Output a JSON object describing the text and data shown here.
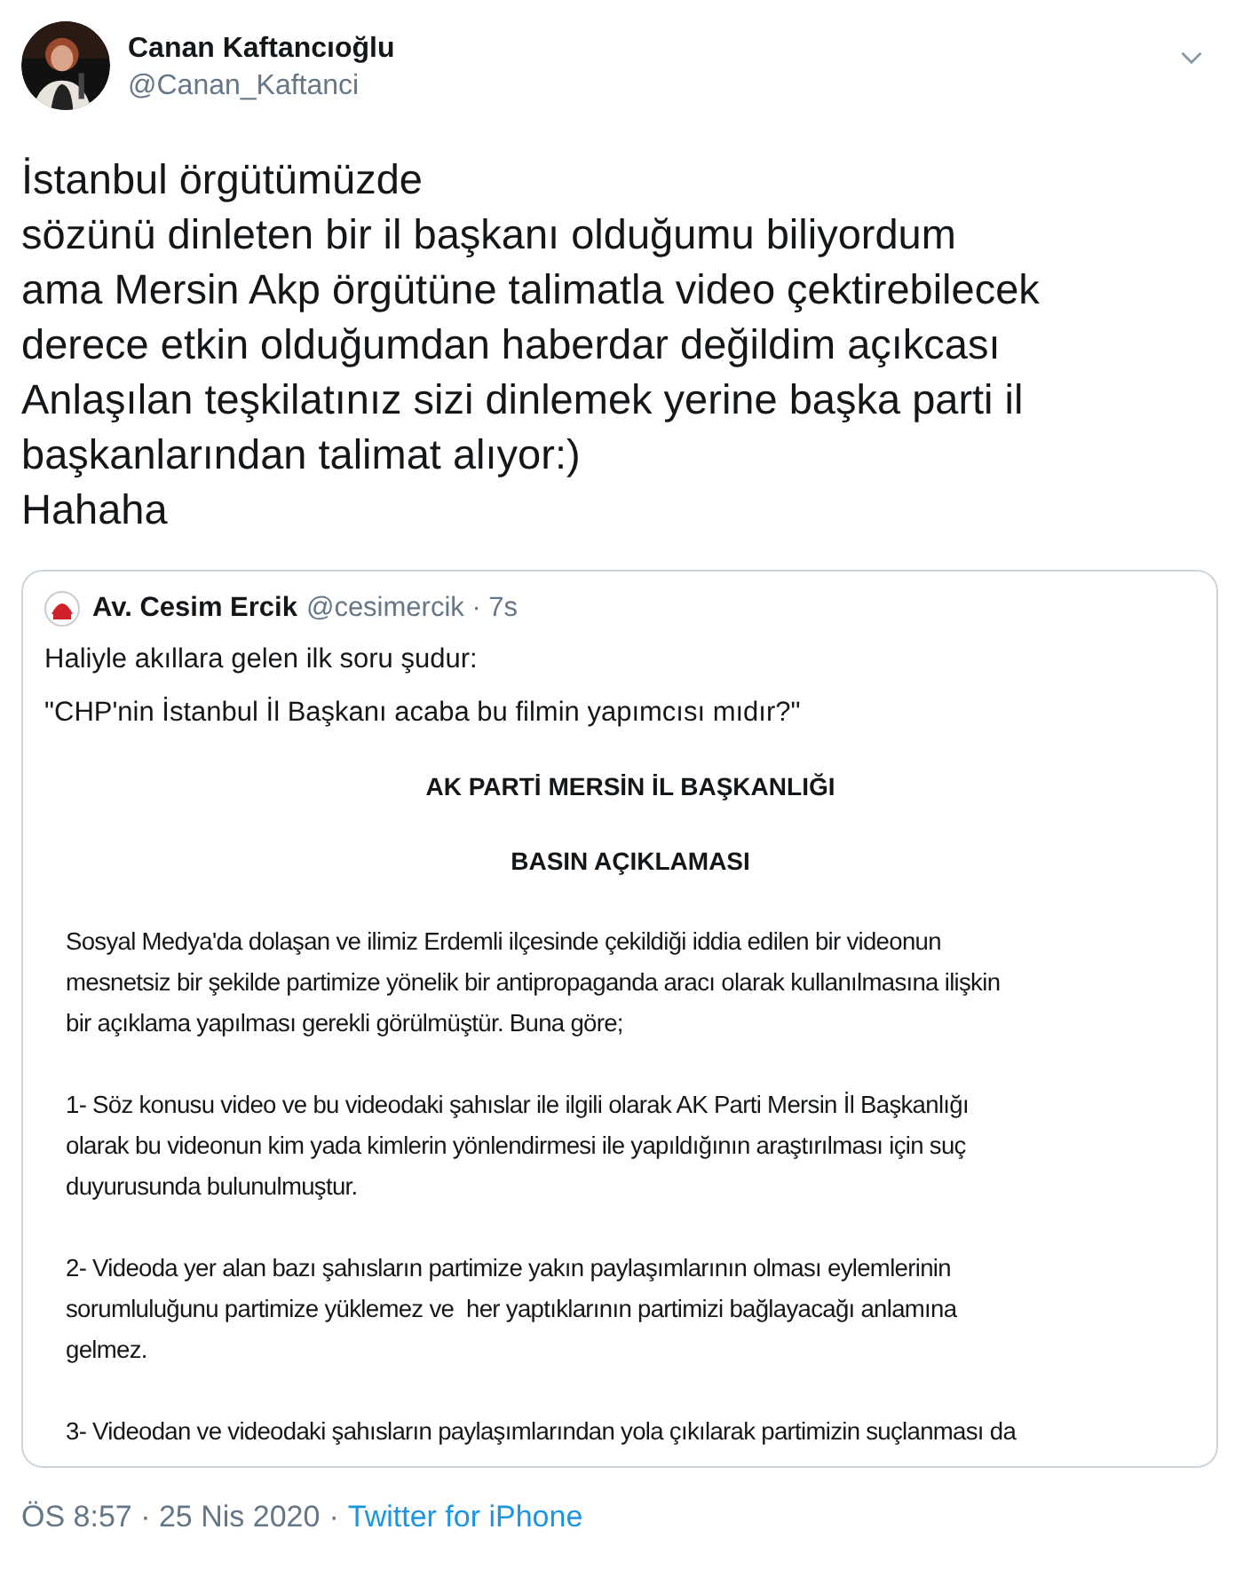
{
  "tweet": {
    "author": {
      "name": "Canan Kaftancıoğlu",
      "handle": "@Canan_Kaftanci"
    },
    "text": "İstanbul örgütümüzde\nsözünü dinleten bir il başkanı olduğumu biliyordum\nama Mersin Akp örgütüne talimatla video çektirebilecek\nderece etkin olduğumdan haberdar değildim açıkcası\nAnlaşılan teşkilatınız sizi dinlemek yerine başka parti il\nbaşkanlarından talimat alıyor:)\nHahaha",
    "quoted": {
      "author": {
        "name": "Av. Cesim Ercik",
        "meta": "@cesimercik · 7s"
      },
      "text": [
        "Haliyle akıllara gelen ilk soru şudur:",
        "\"CHP'nin İstanbul İl Başkanı acaba bu filmin yapımcısı mıdır?\""
      ],
      "document": {
        "headings": [
          "AK PARTİ MERSİN İL BAŞKANLIĞI",
          "BASIN AÇIKLAMASI"
        ],
        "paragraphs": [
          "Sosyal Medya'da dolaşan ve ilimiz Erdemli ilçesinde çekildiği iddia edilen bir videonun\nmesnetsiz bir şekilde partimize yönelik bir antipropaganda aracı olarak kullanılmasına ilişkin\nbir açıklama yapılması gerekli görülmüştür. Buna göre;",
          "1- Söz konusu video ve bu videodaki şahıslar ile ilgili olarak AK Parti Mersin İl Başkanlığı\nolarak bu videonun kim yada kimlerin yönlendirmesi ile yapıldığının araştırılması için suç\nduyurusunda bulunulmuştur.",
          "2- Videoda yer alan bazı şahısların partimize yakın paylaşımlarının olması eylemlerinin\nsorumluluğunu partimize yüklemez ve  her yaptıklarının partimizi bağlayacağı anlamına\ngelmez.",
          "3- Videodan ve videodaki şahısların paylaşımlarından yola çıkılarak partimizin suçlanması da"
        ]
      }
    },
    "footer": {
      "time": "ÖS 8:57 · 25 Nis 2020",
      "separator": "·",
      "source": "Twitter for iPhone"
    }
  }
}
